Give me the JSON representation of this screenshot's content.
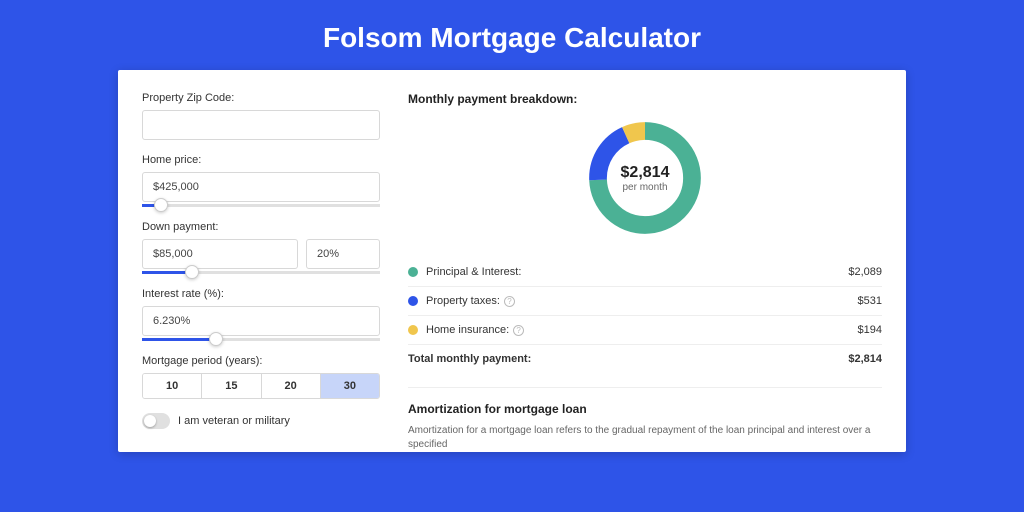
{
  "title": "Folsom Mortgage Calculator",
  "form": {
    "zip": {
      "label": "Property Zip Code:",
      "value": ""
    },
    "home": {
      "label": "Home price:",
      "value": "$425,000",
      "slider_pct": 8
    },
    "down": {
      "label": "Down payment:",
      "value": "$85,000",
      "pct": "20%",
      "slider_pct": 21
    },
    "rate": {
      "label": "Interest rate (%):",
      "value": "6.230%",
      "slider_pct": 31
    },
    "period": {
      "label": "Mortgage period (years):",
      "options": [
        "10",
        "15",
        "20",
        "30"
      ],
      "selected": 3
    },
    "veteran": {
      "label": "I am veteran or military",
      "on": false
    }
  },
  "breakdown": {
    "title": "Monthly payment breakdown:",
    "center_amount": "$2,814",
    "center_sub": "per month",
    "items": [
      {
        "label": "Principal & Interest:",
        "value": "$2,089",
        "color": "#4bb195",
        "help": false
      },
      {
        "label": "Property taxes:",
        "value": "$531",
        "color": "#2e54e8",
        "help": true
      },
      {
        "label": "Home insurance:",
        "value": "$194",
        "color": "#f0c64d",
        "help": true
      }
    ],
    "total": {
      "label": "Total monthly payment:",
      "value": "$2,814"
    }
  },
  "chart_data": {
    "type": "pie",
    "title": "Monthly payment breakdown",
    "series": [
      {
        "name": "Principal & Interest",
        "value": 2089,
        "color": "#4bb195"
      },
      {
        "name": "Property taxes",
        "value": 531,
        "color": "#2e54e8"
      },
      {
        "name": "Home insurance",
        "value": 194,
        "color": "#f0c64d"
      }
    ],
    "total": 2814,
    "values_label": "$ per month"
  },
  "amort": {
    "title": "Amortization for mortgage loan",
    "text": "Amortization for a mortgage loan refers to the gradual repayment of the loan principal and interest over a specified"
  }
}
